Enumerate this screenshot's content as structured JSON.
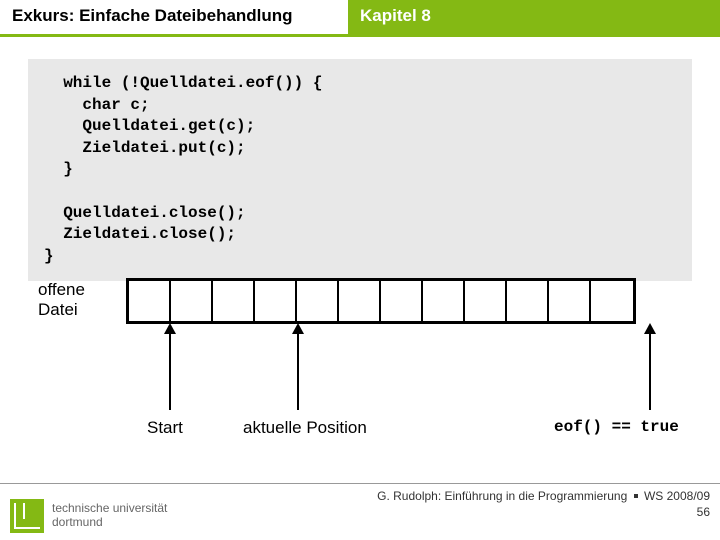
{
  "header": {
    "title_left": "Exkurs: Einfache Dateibehandlung",
    "title_right": "Kapitel 8"
  },
  "code": "  while (!Quelldatei.eof()) {\n    char c;\n    Quelldatei.get(c);\n    Zieldatei.put(c);\n  }\n\n  Quelldatei.close();\n  Zieldatei.close();\n}",
  "diagram": {
    "label_line1": "offene",
    "label_line2": "Datei",
    "cell_count": 12,
    "caption_start": "Start",
    "caption_current": "aktuelle Position",
    "caption_eof": "eof() == true"
  },
  "footer": {
    "text_line1_left": "G. Rudolph: Einführung in die Programmierung",
    "text_line1_right": "WS 2008/09",
    "page": "56"
  },
  "logo": {
    "line1": "technische universität",
    "line2": "dortmund"
  }
}
